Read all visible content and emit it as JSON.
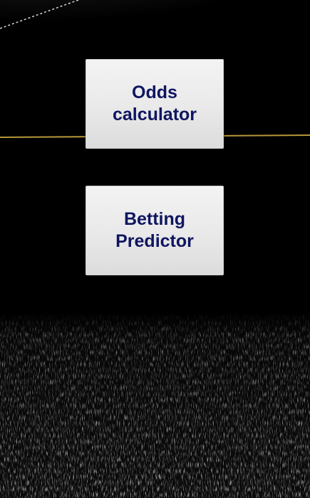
{
  "menu": {
    "odds_calculator_label": "Odds\ncalculator",
    "betting_predictor_label": "Betting\nPredictor"
  },
  "colors": {
    "button_text": "#0f1660",
    "button_face": "#e9e9e9",
    "background": "#000000",
    "field_line": "#b8973a"
  }
}
